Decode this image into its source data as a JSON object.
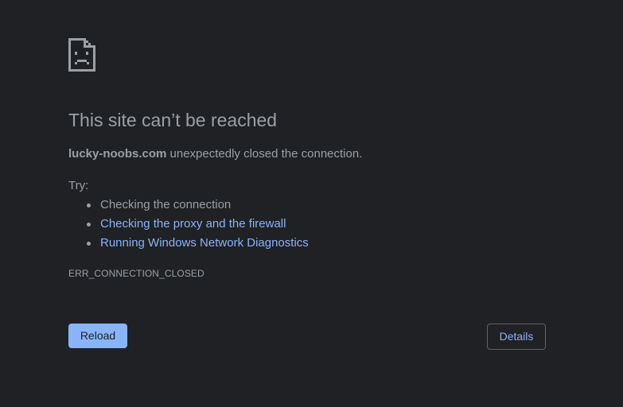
{
  "error": {
    "icon": "sad-page-icon",
    "title": "This site can’t be reached",
    "host": "lucky-noobs.com",
    "message": " unexpectedly closed the connection.",
    "try_label": "Try:",
    "suggestions": [
      {
        "text": "Checking the connection",
        "is_link": false
      },
      {
        "text": "Checking the proxy and the firewall",
        "is_link": true
      },
      {
        "text": "Running Windows Network Diagnostics",
        "is_link": true
      }
    ],
    "code": "ERR_CONNECTION_CLOSED"
  },
  "buttons": {
    "reload_label": "Reload",
    "details_label": "Details"
  },
  "colors": {
    "background": "#202124",
    "text": "#9aa0a6",
    "link": "#8ab4f8",
    "primary_button": "#8ab4f8",
    "outline": "#5f6368"
  }
}
